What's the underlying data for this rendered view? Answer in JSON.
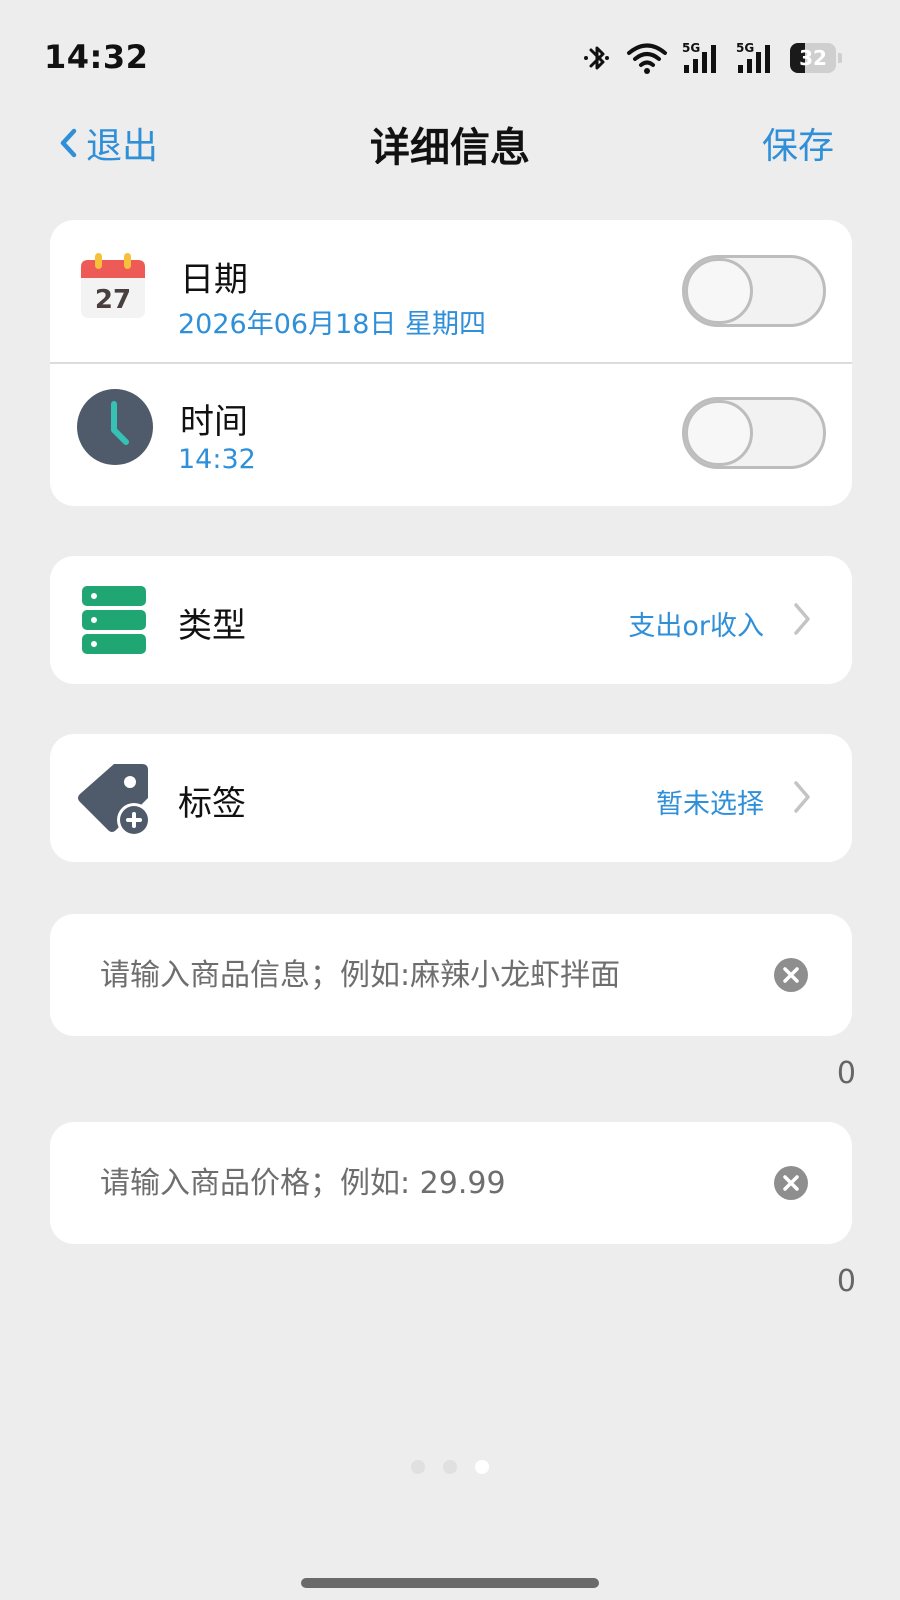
{
  "status_bar": {
    "time": "14:32",
    "battery": "32",
    "battery_level": 0.32,
    "network_1": "5G",
    "network_2": "5G"
  },
  "nav": {
    "back_label": "退出",
    "title": "详细信息",
    "save_label": "保存"
  },
  "datetime_card": {
    "date": {
      "label": "日期",
      "value": "2026年06月18日 星期四",
      "calendar_day": "27",
      "enabled": false
    },
    "time": {
      "label": "时间",
      "value": "14:32",
      "enabled": false
    }
  },
  "type_row": {
    "label": "类型",
    "value": "支出or收入"
  },
  "tag_row": {
    "label": "标签",
    "value": "暂未选择"
  },
  "product_info": {
    "placeholder": "请输入商品信息；例如:麻辣小龙虾拌面",
    "value": "",
    "count": "0"
  },
  "product_price": {
    "placeholder": "请输入商品价格；例如: 29.99",
    "value": "",
    "count": "0"
  },
  "pager": {
    "total": 3,
    "active_index": 2
  },
  "colors": {
    "accent": "#2f8fd8",
    "background": "#ededed",
    "calendar_red": "#ee5a56",
    "type_green": "#1fa672",
    "icon_slate": "#4f5b6a",
    "clock_hand": "#35c2b5"
  }
}
